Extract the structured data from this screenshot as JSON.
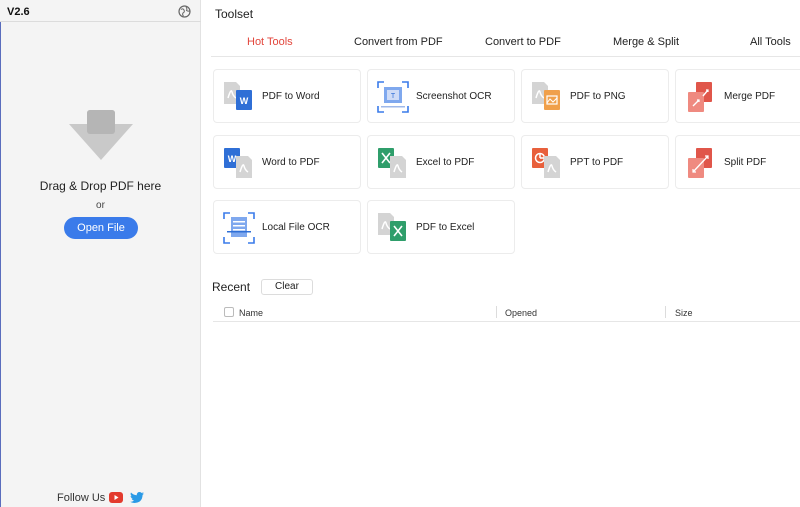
{
  "app": {
    "version": "V2.6"
  },
  "sidebar": {
    "drag_text": "Drag & Drop PDF here",
    "or_text": "or",
    "open_button": "Open File",
    "follow_text": "Follow Us"
  },
  "main": {
    "title": "Toolset",
    "tabs": [
      {
        "label": "Hot Tools",
        "active": true
      },
      {
        "label": "Convert from PDF",
        "active": false
      },
      {
        "label": "Convert to PDF",
        "active": false
      },
      {
        "label": "Merge & Split",
        "active": false
      },
      {
        "label": "All Tools",
        "active": false
      }
    ],
    "tools": [
      {
        "label": "PDF to Word",
        "icon": "pdf-to-word-icon"
      },
      {
        "label": "Screenshot OCR",
        "icon": "screenshot-ocr-icon"
      },
      {
        "label": "PDF to PNG",
        "icon": "pdf-to-png-icon"
      },
      {
        "label": "Merge PDF",
        "icon": "merge-pdf-icon"
      },
      {
        "label": "Word to PDF",
        "icon": "word-to-pdf-icon"
      },
      {
        "label": "Excel to PDF",
        "icon": "excel-to-pdf-icon"
      },
      {
        "label": "PPT to PDF",
        "icon": "ppt-to-pdf-icon"
      },
      {
        "label": "Split PDF",
        "icon": "split-pdf-icon"
      },
      {
        "label": "Local File OCR",
        "icon": "local-file-ocr-icon"
      },
      {
        "label": "PDF to Excel",
        "icon": "pdf-to-excel-icon"
      }
    ],
    "recent": {
      "title": "Recent",
      "clear_button": "Clear",
      "columns": [
        "Name",
        "Opened",
        "Size"
      ]
    }
  },
  "colors": {
    "accent_blue": "#3a7bea",
    "active_tab": "#e2463c",
    "word_blue": "#2f6fd6",
    "excel_green": "#2f9e6b",
    "ppt_orange": "#e8603c",
    "png_orange": "#f0a04b",
    "merge_red": "#e0564a"
  }
}
